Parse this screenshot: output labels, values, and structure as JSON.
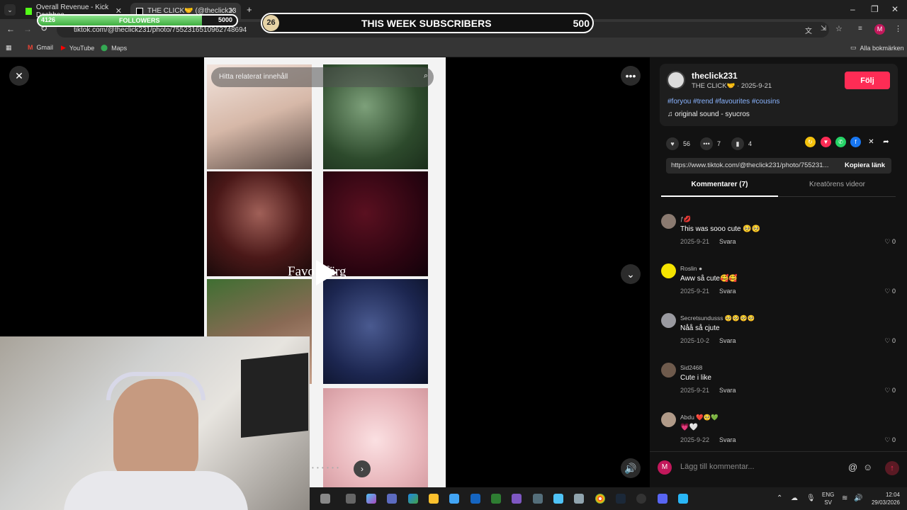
{
  "browser": {
    "tabs": [
      {
        "title": "Overall Revenue - Kick Dashboa",
        "active": false,
        "favicon_color": "#53fc18"
      },
      {
        "title": "THE CLICK🤝 (@theclick23",
        "active": true,
        "favicon_color": "#ffffff"
      }
    ],
    "new_tab_label": "+",
    "url": "tiktok.com/@theclick231/photo/7552316510962748694",
    "bookmarks": [
      {
        "label": "Gmail",
        "icon": "gmail-icon"
      },
      {
        "label": "YouTube",
        "icon": "youtube-icon"
      },
      {
        "label": "Maps",
        "icon": "maps-icon"
      }
    ],
    "all_bookmarks_label": "Alla bokmärken"
  },
  "overlay": {
    "followers_label": "FOLLOWERS",
    "followers_current": "4126",
    "followers_goal": "5000",
    "followers_progress": 0.8252,
    "subs_count": "26",
    "subs_label": "THIS WEEK SUBSCRIBERS",
    "subs_goal": "500"
  },
  "viewer": {
    "search_placeholder": "Hitta relaterat innehåll",
    "center_text": "Favo   färg",
    "pagination": "• • • • • •"
  },
  "post": {
    "username": "theclick231",
    "display_name": "THE CLICK🤝",
    "date": "2025-9-21",
    "follow_label": "Följ",
    "hashtags": "#foryou #trend #favourites #cousins",
    "sound": "original sound - syucros",
    "likes": "56",
    "comments_count": "7",
    "saves": "4",
    "link": "https://www.tiktok.com/@theclick231/photo/755231...",
    "copy_link_label": "Kopiera länk",
    "tab_comments": "Kommentarer (7)",
    "tab_creator": "Kreatörens videor",
    "add_comment_placeholder": "Lägg till kommentar..."
  },
  "comments": [
    {
      "user": "ƒ💋",
      "text": "This was sooo cute 🥺🥺",
      "date": "2025-9-21",
      "reply": "Svara",
      "likes": "0",
      "avatar_color": "#8a7a70"
    },
    {
      "user": "Roslin ●",
      "text": "Aww så cute🥰🥰",
      "date": "2025-9-21",
      "reply": "Svara",
      "likes": "0",
      "avatar_color": "#f5e400"
    },
    {
      "user": "Secretsundusss 🥺🥺🥺🥺",
      "text": "Nåå så cjute",
      "date": "2025-10-2",
      "reply": "Svara",
      "likes": "0",
      "avatar_color": "#9a9aa0"
    },
    {
      "user": "Sid2468",
      "text": "Cute i like",
      "date": "2025-9-21",
      "reply": "Svara",
      "likes": "0",
      "avatar_color": "#6e5a4c"
    },
    {
      "user": "Abdu ❤️🥺💚",
      "text": "💗🤍",
      "date": "2025-9-22",
      "reply": "Svara",
      "likes": "0",
      "avatar_color": "#b09a88"
    }
  ],
  "taskbar": {
    "lang_top": "ENG",
    "lang_bottom": "SV",
    "time": "12:04",
    "date": "29/03/2026"
  },
  "colors": {
    "accent": "#fe2c55",
    "panel_bg": "#121212",
    "hashtag": "#8ab4ff"
  }
}
